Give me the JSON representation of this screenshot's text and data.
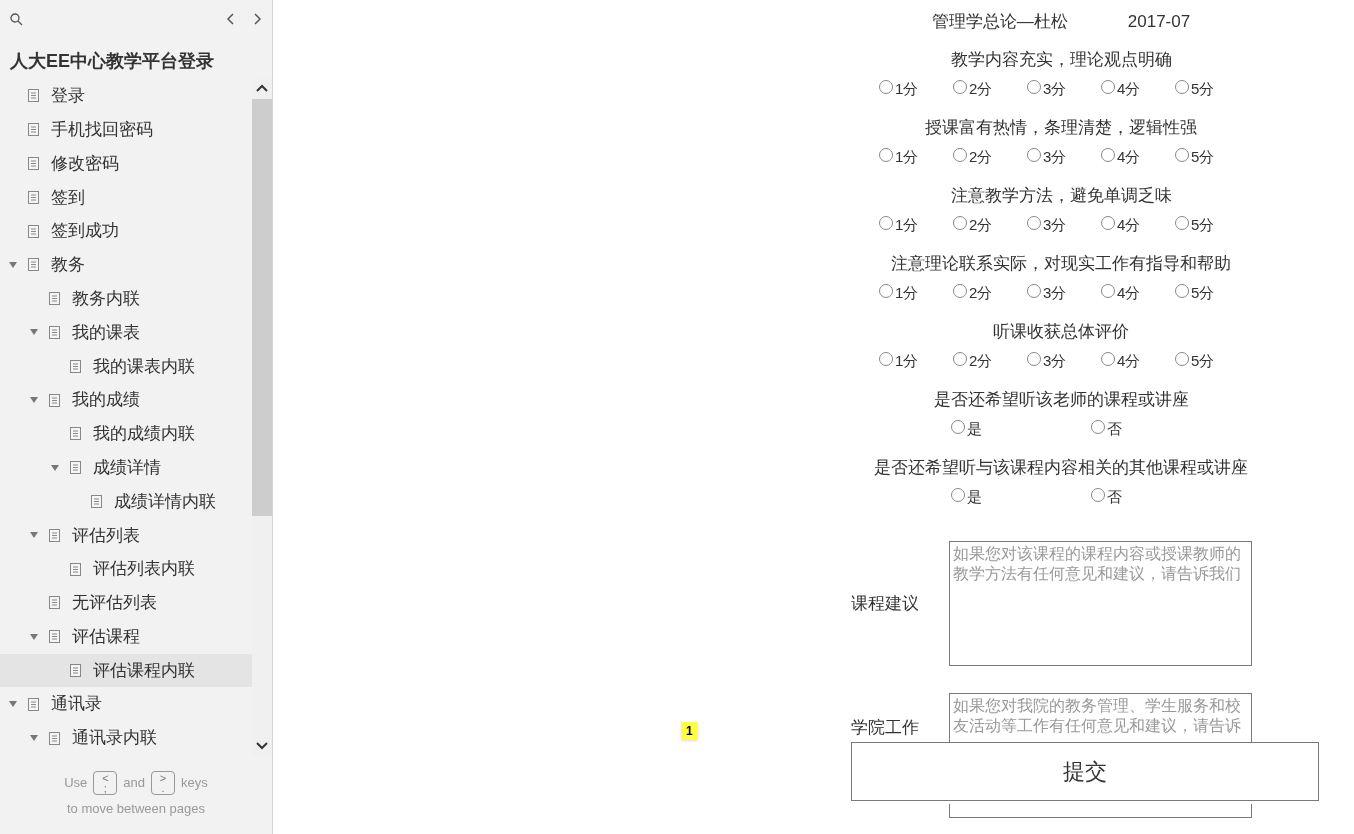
{
  "sidebar": {
    "title": "人大EE中心教学平台登录",
    "tree": [
      {
        "label": "登录",
        "selected": false
      },
      {
        "label": "手机找回密码",
        "selected": false
      },
      {
        "label": "修改密码",
        "selected": false
      },
      {
        "label": "签到",
        "selected": false
      },
      {
        "label": "签到成功",
        "selected": false
      },
      {
        "label": "教务",
        "selected": false,
        "expanded": true,
        "children": [
          {
            "label": "教务内联",
            "selected": false
          },
          {
            "label": "我的课表",
            "selected": false,
            "expanded": true,
            "children": [
              {
                "label": "我的课表内联",
                "selected": false
              }
            ]
          },
          {
            "label": "我的成绩",
            "selected": false,
            "expanded": true,
            "children": [
              {
                "label": "我的成绩内联",
                "selected": false
              },
              {
                "label": "成绩详情",
                "selected": false,
                "expanded": true,
                "children": [
                  {
                    "label": "成绩详情内联",
                    "selected": false
                  }
                ]
              }
            ]
          },
          {
            "label": "评估列表",
            "selected": false,
            "expanded": true,
            "children": [
              {
                "label": "评估列表内联",
                "selected": false
              }
            ]
          },
          {
            "label": "无评估列表",
            "selected": false
          },
          {
            "label": "评估课程",
            "selected": false,
            "expanded": true,
            "children": [
              {
                "label": "评估课程内联",
                "selected": true
              }
            ]
          }
        ]
      },
      {
        "label": "通讯录",
        "selected": false,
        "expanded": true,
        "children": [
          {
            "label": "通讯录内联",
            "selected": false,
            "expanded": true
          }
        ]
      }
    ],
    "hint_line1": [
      {
        "kind": "text",
        "text": "Use"
      },
      {
        "kind": "key",
        "top": "<",
        "bottom": ";"
      },
      {
        "kind": "text",
        "text": "and"
      },
      {
        "kind": "key",
        "top": ">",
        "bottom": "."
      },
      {
        "kind": "text",
        "text": "keys"
      }
    ],
    "hint_line2": "to move between pages"
  },
  "form": {
    "course": "管理学总论—杜松",
    "date": "2017-07",
    "questions": [
      {
        "text": "教学内容充实，理论观点明确",
        "kind": "score",
        "options": [
          {
            "label": "1分",
            "selected": false
          },
          {
            "label": "2分",
            "selected": false
          },
          {
            "label": "3分",
            "selected": false
          },
          {
            "label": "4分",
            "selected": false
          },
          {
            "label": "5分",
            "selected": false
          }
        ]
      },
      {
        "text": "授课富有热情，条理清楚，逻辑性强",
        "kind": "score",
        "options": [
          {
            "label": "1分",
            "selected": false
          },
          {
            "label": "2分",
            "selected": false
          },
          {
            "label": "3分",
            "selected": false
          },
          {
            "label": "4分",
            "selected": false
          },
          {
            "label": "5分",
            "selected": false
          }
        ]
      },
      {
        "text": "注意教学方法，避免单调乏味",
        "kind": "score",
        "options": [
          {
            "label": "1分",
            "selected": false
          },
          {
            "label": "2分",
            "selected": false
          },
          {
            "label": "3分",
            "selected": false
          },
          {
            "label": "4分",
            "selected": false
          },
          {
            "label": "5分",
            "selected": false
          }
        ]
      },
      {
        "text": "注意理论联系实际，对现实工作有指导和帮助",
        "kind": "score",
        "options": [
          {
            "label": "1分",
            "selected": false
          },
          {
            "label": "2分",
            "selected": false
          },
          {
            "label": "3分",
            "selected": false
          },
          {
            "label": "4分",
            "selected": false
          },
          {
            "label": "5分",
            "selected": false
          }
        ]
      },
      {
        "text": "听课收获总体评价",
        "kind": "score",
        "options": [
          {
            "label": "1分",
            "selected": false
          },
          {
            "label": "2分",
            "selected": false
          },
          {
            "label": "3分",
            "selected": false
          },
          {
            "label": "4分",
            "selected": false
          },
          {
            "label": "5分",
            "selected": false
          }
        ]
      },
      {
        "text": "是否还希望听该老师的课程或讲座",
        "kind": "yesno",
        "options": [
          {
            "label": "是",
            "selected": false
          },
          {
            "label": "否",
            "selected": false
          }
        ]
      },
      {
        "text": "是否还希望听与该课程内容相关的其他课程或讲座",
        "kind": "yesno",
        "options": [
          {
            "label": "是",
            "selected": false
          },
          {
            "label": "否",
            "selected": false
          }
        ]
      }
    ],
    "comments": [
      {
        "label": "课程建议",
        "placeholder": "如果您对该课程的课程内容或授课教师的教学方法有任何意见和建议，请告诉我们"
      },
      {
        "label": "学院工作",
        "placeholder": "如果您对我院的教务管理、学生服务和校友活动等工作有任何意见和建议，请告诉"
      }
    ],
    "submit": "提交",
    "footnote": "1"
  }
}
